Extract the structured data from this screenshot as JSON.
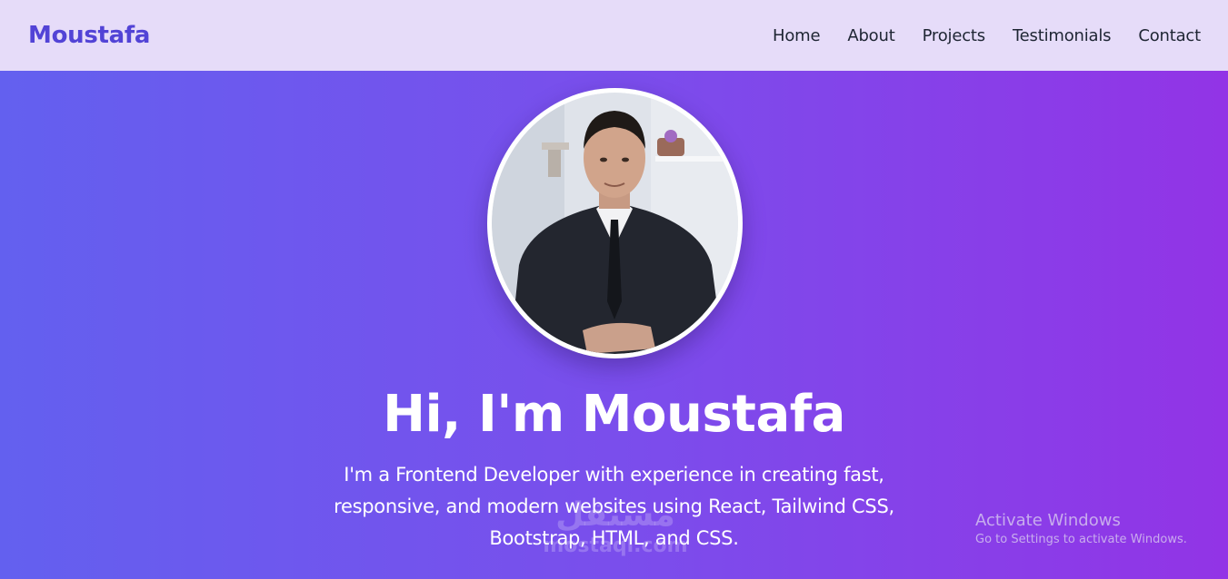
{
  "navbar": {
    "brand": "Moustafa",
    "links": [
      {
        "label": "Home"
      },
      {
        "label": "About"
      },
      {
        "label": "Projects"
      },
      {
        "label": "Testimonials"
      },
      {
        "label": "Contact"
      }
    ]
  },
  "hero": {
    "title": "Hi, I'm Moustafa",
    "description": "I'm a Frontend Developer with experience in creating fast, responsive, and modern websites using React, Tailwind CSS, Bootstrap, HTML, and CSS."
  },
  "watermark": {
    "arabic": "مستقل",
    "latin": "mostaql.com"
  },
  "os_overlay": {
    "title": "Activate Windows",
    "subtitle": "Go to Settings to activate Windows."
  },
  "colors": {
    "brand": "#5243d6",
    "navbar_bg": "#e6dcf9",
    "gradient_start": "#6360ef",
    "gradient_end": "#9234e6"
  }
}
